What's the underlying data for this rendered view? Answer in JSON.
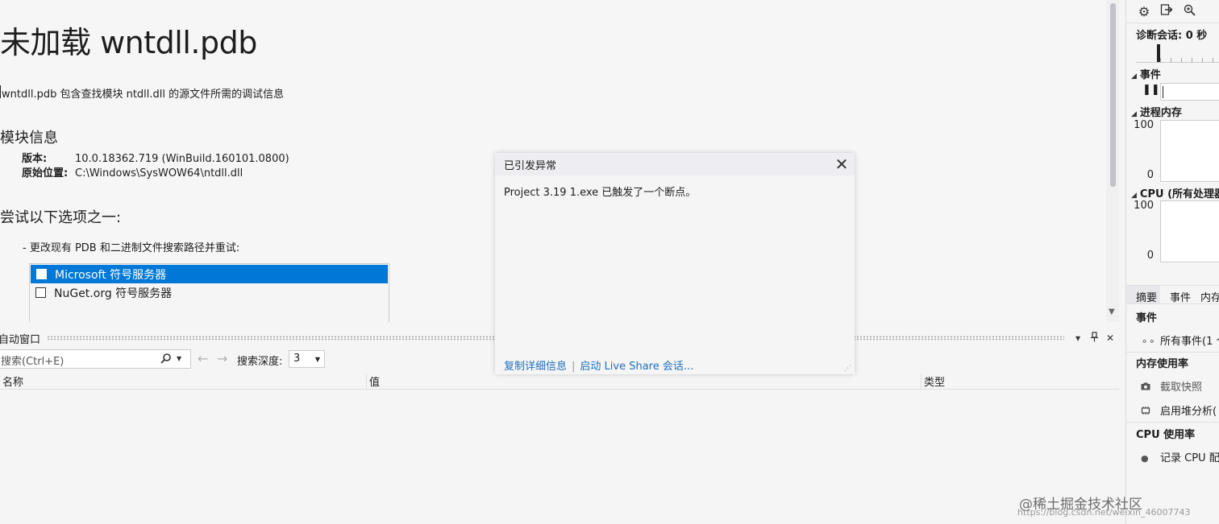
{
  "document": {
    "title": "未加载 wntdll.pdb",
    "description": "wntdll.pdb 包含查找模块 ntdll.dll 的源文件所需的调试信息",
    "module_heading": "模块信息",
    "version_label": "版本:",
    "version_value": "10.0.18362.719 (WinBuild.160101.0800)",
    "location_label": "原始位置:",
    "location_value": "C:\\Windows\\SysWOW64\\ntdll.dll",
    "try_heading": "尝试以下选项之一:",
    "option_text": "-  更改现有 PDB 和二进制文件搜索路径并重试:",
    "symbol_servers": [
      {
        "label": "Microsoft 符号服务器",
        "checked": false,
        "selected": true
      },
      {
        "label": "NuGet.org 符号服务器",
        "checked": false,
        "selected": false
      }
    ]
  },
  "autos": {
    "title": "自动窗口",
    "search_placeholder": "搜索(Ctrl+E)",
    "depth_label": "搜索深度:",
    "depth_value": "3",
    "columns": [
      "名称",
      "值",
      "类型"
    ],
    "icons": {
      "dropdown": "chevron-down-icon",
      "pin": "pin-icon",
      "close": "close-icon",
      "search": "search-icon",
      "back": "arrow-left-icon",
      "forward": "arrow-right-icon"
    }
  },
  "exception": {
    "title": "已引发异常",
    "message": "Project 3.19 1.exe 已触发了一个断点。",
    "copy_details": "复制详细信息",
    "live_share": "启动 Live Share 会话..."
  },
  "diagnostics": {
    "session": "诊断会话: 0 秒",
    "events_section": "事件",
    "memory_section": "进程内存",
    "memory_max": "100",
    "memory_min": "0",
    "cpu_section": "CPU (所有处理器",
    "cpu_max": "100",
    "cpu_min": "0",
    "tabs": [
      "摘要",
      "事件",
      "内存"
    ],
    "events_heading": "事件",
    "all_events": "所有事件(1 个",
    "memory_usage_heading": "内存使用率",
    "take_snapshot": "截取快照",
    "heap_analysis": "启用堆分析(",
    "cpu_usage_heading": "CPU 使用率",
    "record_cpu": "记录 CPU 配"
  },
  "watermark": {
    "main": "@稀土掘金技术社区",
    "sub": "https://blog.csdn.net/weixin_46007743"
  },
  "colors": {
    "selection": "#0078d7",
    "link": "#1e6fbf",
    "background": "#f5f5f5"
  }
}
